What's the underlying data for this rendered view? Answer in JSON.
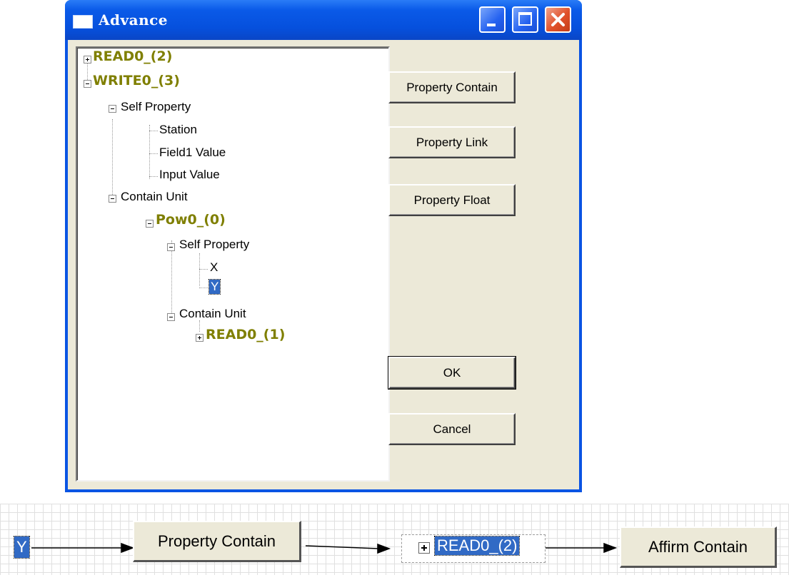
{
  "window": {
    "title": "Advance",
    "controls": [
      "minimize",
      "maximize",
      "close"
    ]
  },
  "tree": [
    {
      "label": "READ0_(2)",
      "kind": "unit",
      "expanded": false
    },
    {
      "label": "WRITE0_(3)",
      "kind": "unit",
      "expanded": true
    },
    {
      "label": "Self Property",
      "kind": "prop"
    },
    {
      "label": "Station",
      "kind": "prop"
    },
    {
      "label": "Field1 Value",
      "kind": "prop"
    },
    {
      "label": "Input Value",
      "kind": "prop"
    },
    {
      "label": "Contain Unit",
      "kind": "prop"
    },
    {
      "label": "Pow0_(0)",
      "kind": "unit",
      "expanded": true
    },
    {
      "label": "Self Property",
      "kind": "prop"
    },
    {
      "label": "X",
      "kind": "prop"
    },
    {
      "label": "Y",
      "kind": "prop",
      "selected": true
    },
    {
      "label": "Contain Unit",
      "kind": "prop"
    },
    {
      "label": "READ0_(1)",
      "kind": "unit",
      "expanded": false
    }
  ],
  "buttons": {
    "property_contain": "Property Contain",
    "property_link": "Property Link",
    "property_float": "Property Float",
    "ok": "OK",
    "cancel": "Cancel"
  },
  "flow": {
    "start": "Y",
    "step1": "Property Contain",
    "step2": "READ0_(2)",
    "step3": "Affirm Contain"
  },
  "colors": {
    "unit_text": "#7f7f00",
    "selection": "#316ac5",
    "dialog_bg": "#ece9d8",
    "titlebar": "#0a54e3"
  }
}
